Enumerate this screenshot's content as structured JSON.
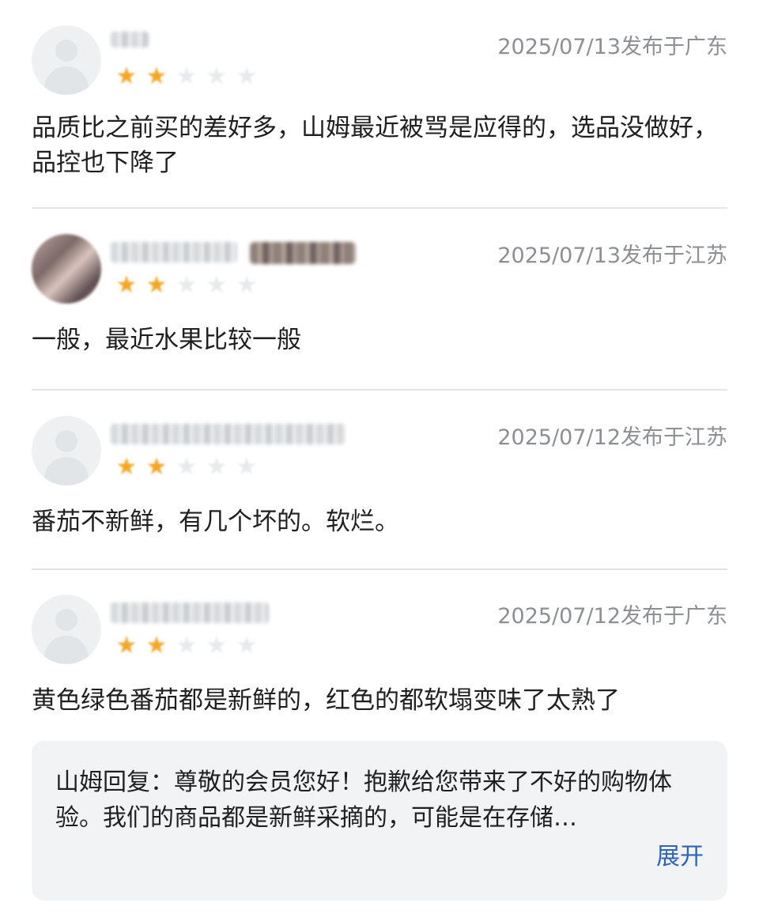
{
  "reviews": [
    {
      "date": "2025/07/13发布于广东",
      "text": "品质比之前买的差好多，山姆最近被骂是应得的，选品没做好，品控也下降了",
      "rating": 2,
      "max_rating": 5
    },
    {
      "date": "2025/07/13发布于江苏",
      "text": "一般，最近水果比较一般",
      "rating": 2,
      "max_rating": 5
    },
    {
      "date": "2025/07/12发布于江苏",
      "text": "番茄不新鲜，有几个坏的。软烂。",
      "rating": 2,
      "max_rating": 5
    },
    {
      "date": "2025/07/12发布于广东",
      "text": "黄色绿色番茄都是新鲜的，红色的都软塌变味了太熟了",
      "rating": 2,
      "max_rating": 5,
      "reply": {
        "text": "山姆回复：尊敬的会员您好！抱歉给您带来了不好的购物体验。我们的商品都是新鲜采摘的，可能是在存储…",
        "expand_label": "展开"
      }
    }
  ],
  "icons": {
    "star_filled": "star-icon",
    "star_empty": "star-outline-icon",
    "avatar_placeholder": "user-placeholder-icon"
  },
  "colors": {
    "star_filled": "#f5a623",
    "star_empty": "#e7e9ec",
    "date_text": "#8c8f94",
    "link": "#2d63b8",
    "reply_bg": "#f2f3f5",
    "divider": "#e4e5e7"
  }
}
